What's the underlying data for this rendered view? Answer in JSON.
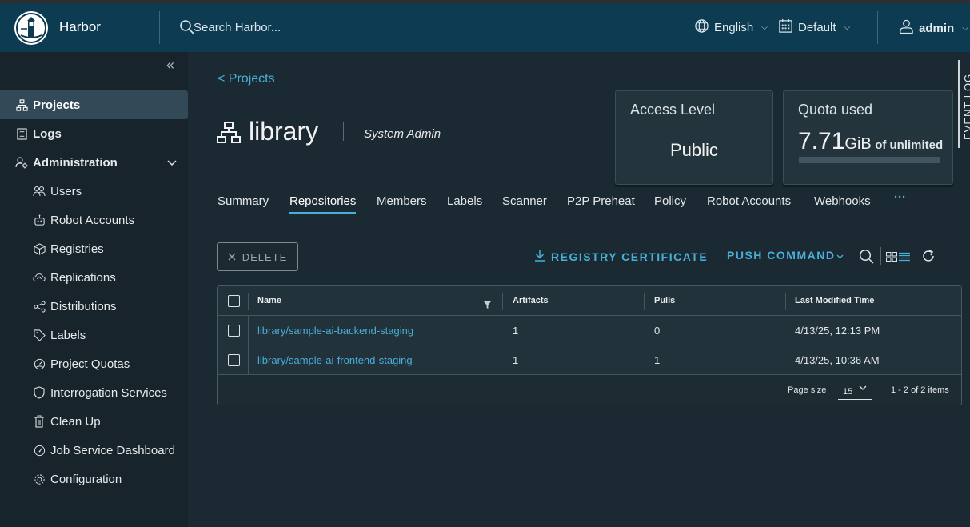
{
  "header": {
    "brand": "Harbor",
    "search_placeholder": "Search Harbor...",
    "language": "English",
    "theme": "Default",
    "user": "admin"
  },
  "sidebar": {
    "items": [
      {
        "label": "Projects",
        "icon": "projects-icon"
      },
      {
        "label": "Logs",
        "icon": "logs-icon"
      },
      {
        "label": "Administration",
        "icon": "administration-icon"
      }
    ],
    "admin_items": [
      {
        "label": "Users",
        "icon": "users-icon"
      },
      {
        "label": "Robot Accounts",
        "icon": "robot-icon"
      },
      {
        "label": "Registries",
        "icon": "registries-icon"
      },
      {
        "label": "Replications",
        "icon": "replications-icon"
      },
      {
        "label": "Distributions",
        "icon": "distributions-icon"
      },
      {
        "label": "Labels",
        "icon": "labels-icon"
      },
      {
        "label": "Project Quotas",
        "icon": "quotas-icon"
      },
      {
        "label": "Interrogation Services",
        "icon": "shield-icon"
      },
      {
        "label": "Clean Up",
        "icon": "trash-icon"
      },
      {
        "label": "Job Service Dashboard",
        "icon": "dashboard-icon"
      },
      {
        "label": "Configuration",
        "icon": "gear-icon"
      }
    ]
  },
  "main": {
    "back_link": "<  Projects",
    "project_name": "library",
    "role": "System Admin",
    "access_card": {
      "title": "Access Level",
      "value": "Public"
    },
    "quota_card": {
      "title": "Quota used",
      "value": "7.71",
      "unit": "GiB",
      "suffix": "of unlimited"
    },
    "event_log": "EVENT LOG",
    "tabs": [
      "Summary",
      "Repositories",
      "Members",
      "Labels",
      "Scanner",
      "P2P Preheat",
      "Policy",
      "Robot Accounts",
      "Webhooks",
      "···"
    ],
    "active_tab": "Repositories",
    "toolbar": {
      "delete": "DELETE",
      "registry_certificate": "REGISTRY CERTIFICATE",
      "push_command": "PUSH COMMAND"
    },
    "table": {
      "columns": [
        "Name",
        "Artifacts",
        "Pulls",
        "Last Modified Time"
      ],
      "rows": [
        {
          "name": "library/sample-ai-backend-staging",
          "artifacts": "1",
          "pulls": "0",
          "modified": "4/13/25, 12:13 PM"
        },
        {
          "name": "library/sample-ai-frontend-staging",
          "artifacts": "1",
          "pulls": "1",
          "modified": "4/13/25, 10:36 AM"
        }
      ],
      "page_size_label": "Page size",
      "page_size": "15",
      "items_count": "1 - 2 of 2 items"
    }
  },
  "colors": {
    "accent": "#49afd9",
    "header_bg": "#0c3b52",
    "page_bg": "#1b2a32"
  }
}
